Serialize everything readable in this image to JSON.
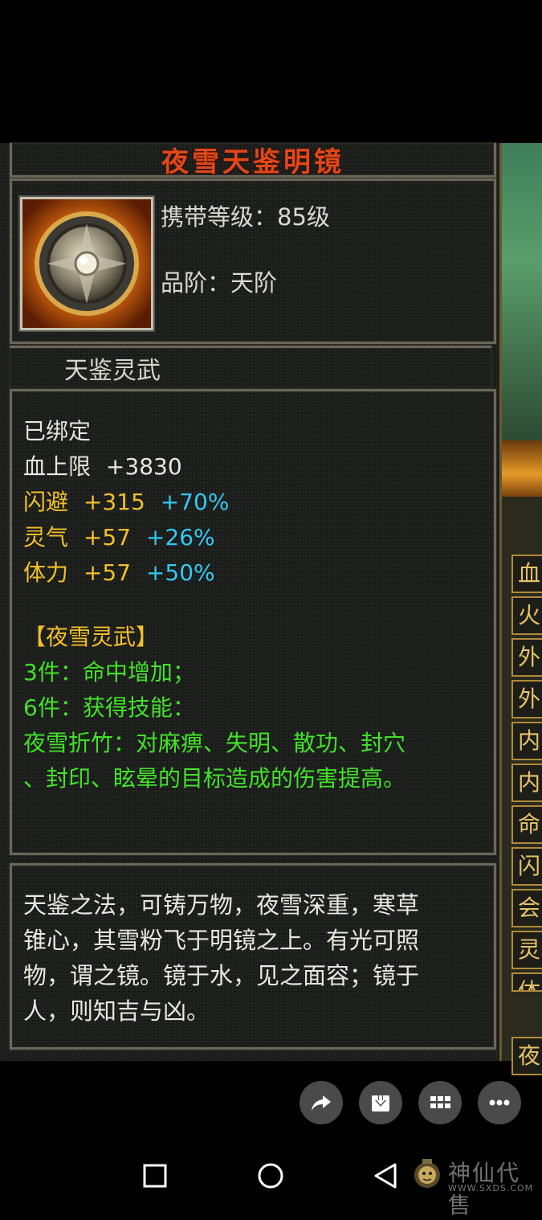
{
  "item": {
    "title": "夜雪天鉴明镜",
    "carry_level": "携带等级：85级",
    "grade": "品阶：天阶",
    "subtitle": "天鉴灵武"
  },
  "attributes": {
    "bound": "已绑定",
    "hp": {
      "label": "血上限",
      "value": "+3830"
    },
    "dodge": {
      "label": "闪避",
      "value": "+315",
      "pct": "+70%"
    },
    "spirit": {
      "label": "灵气",
      "value": "+57",
      "pct": "+26%"
    },
    "stamina": {
      "label": "体力",
      "value": "+57",
      "pct": "+50%"
    }
  },
  "set": {
    "name": "【夜雪灵武】",
    "piece3": "3件：命中增加；",
    "piece6": "6件：获得技能：",
    "skill_line1": "夜雪折竹：对麻痹、失明、散功、封穴",
    "skill_line2": "、封印、眩晕的目标造成的伤害提高。"
  },
  "description": {
    "line1": "天鉴之法，可铸万物，夜雪深重，寒草",
    "line2": "锥心，其雪粉飞于明镜之上。有光可照",
    "line3": "物，谓之镜。镜于水，见之面容；镜于",
    "line4": "人，则知吉与凶。"
  },
  "side_tabs": [
    "血",
    "火",
    "外",
    "外",
    "内",
    "内",
    "命",
    "闪",
    "会",
    "灵",
    "体",
    "夜"
  ],
  "actions": [
    "share-icon",
    "download-icon",
    "grid-icon",
    "more-icon"
  ],
  "nav": [
    "recents-icon",
    "home-icon",
    "back-icon"
  ],
  "watermark": {
    "text": "神仙代售",
    "url": "WWW.SXDS.COM"
  },
  "colors": {
    "title": "#e0481a",
    "yellow": "#f1c02a",
    "cyan": "#35c8f2",
    "green": "#43e12a",
    "border": "#6c665a"
  }
}
